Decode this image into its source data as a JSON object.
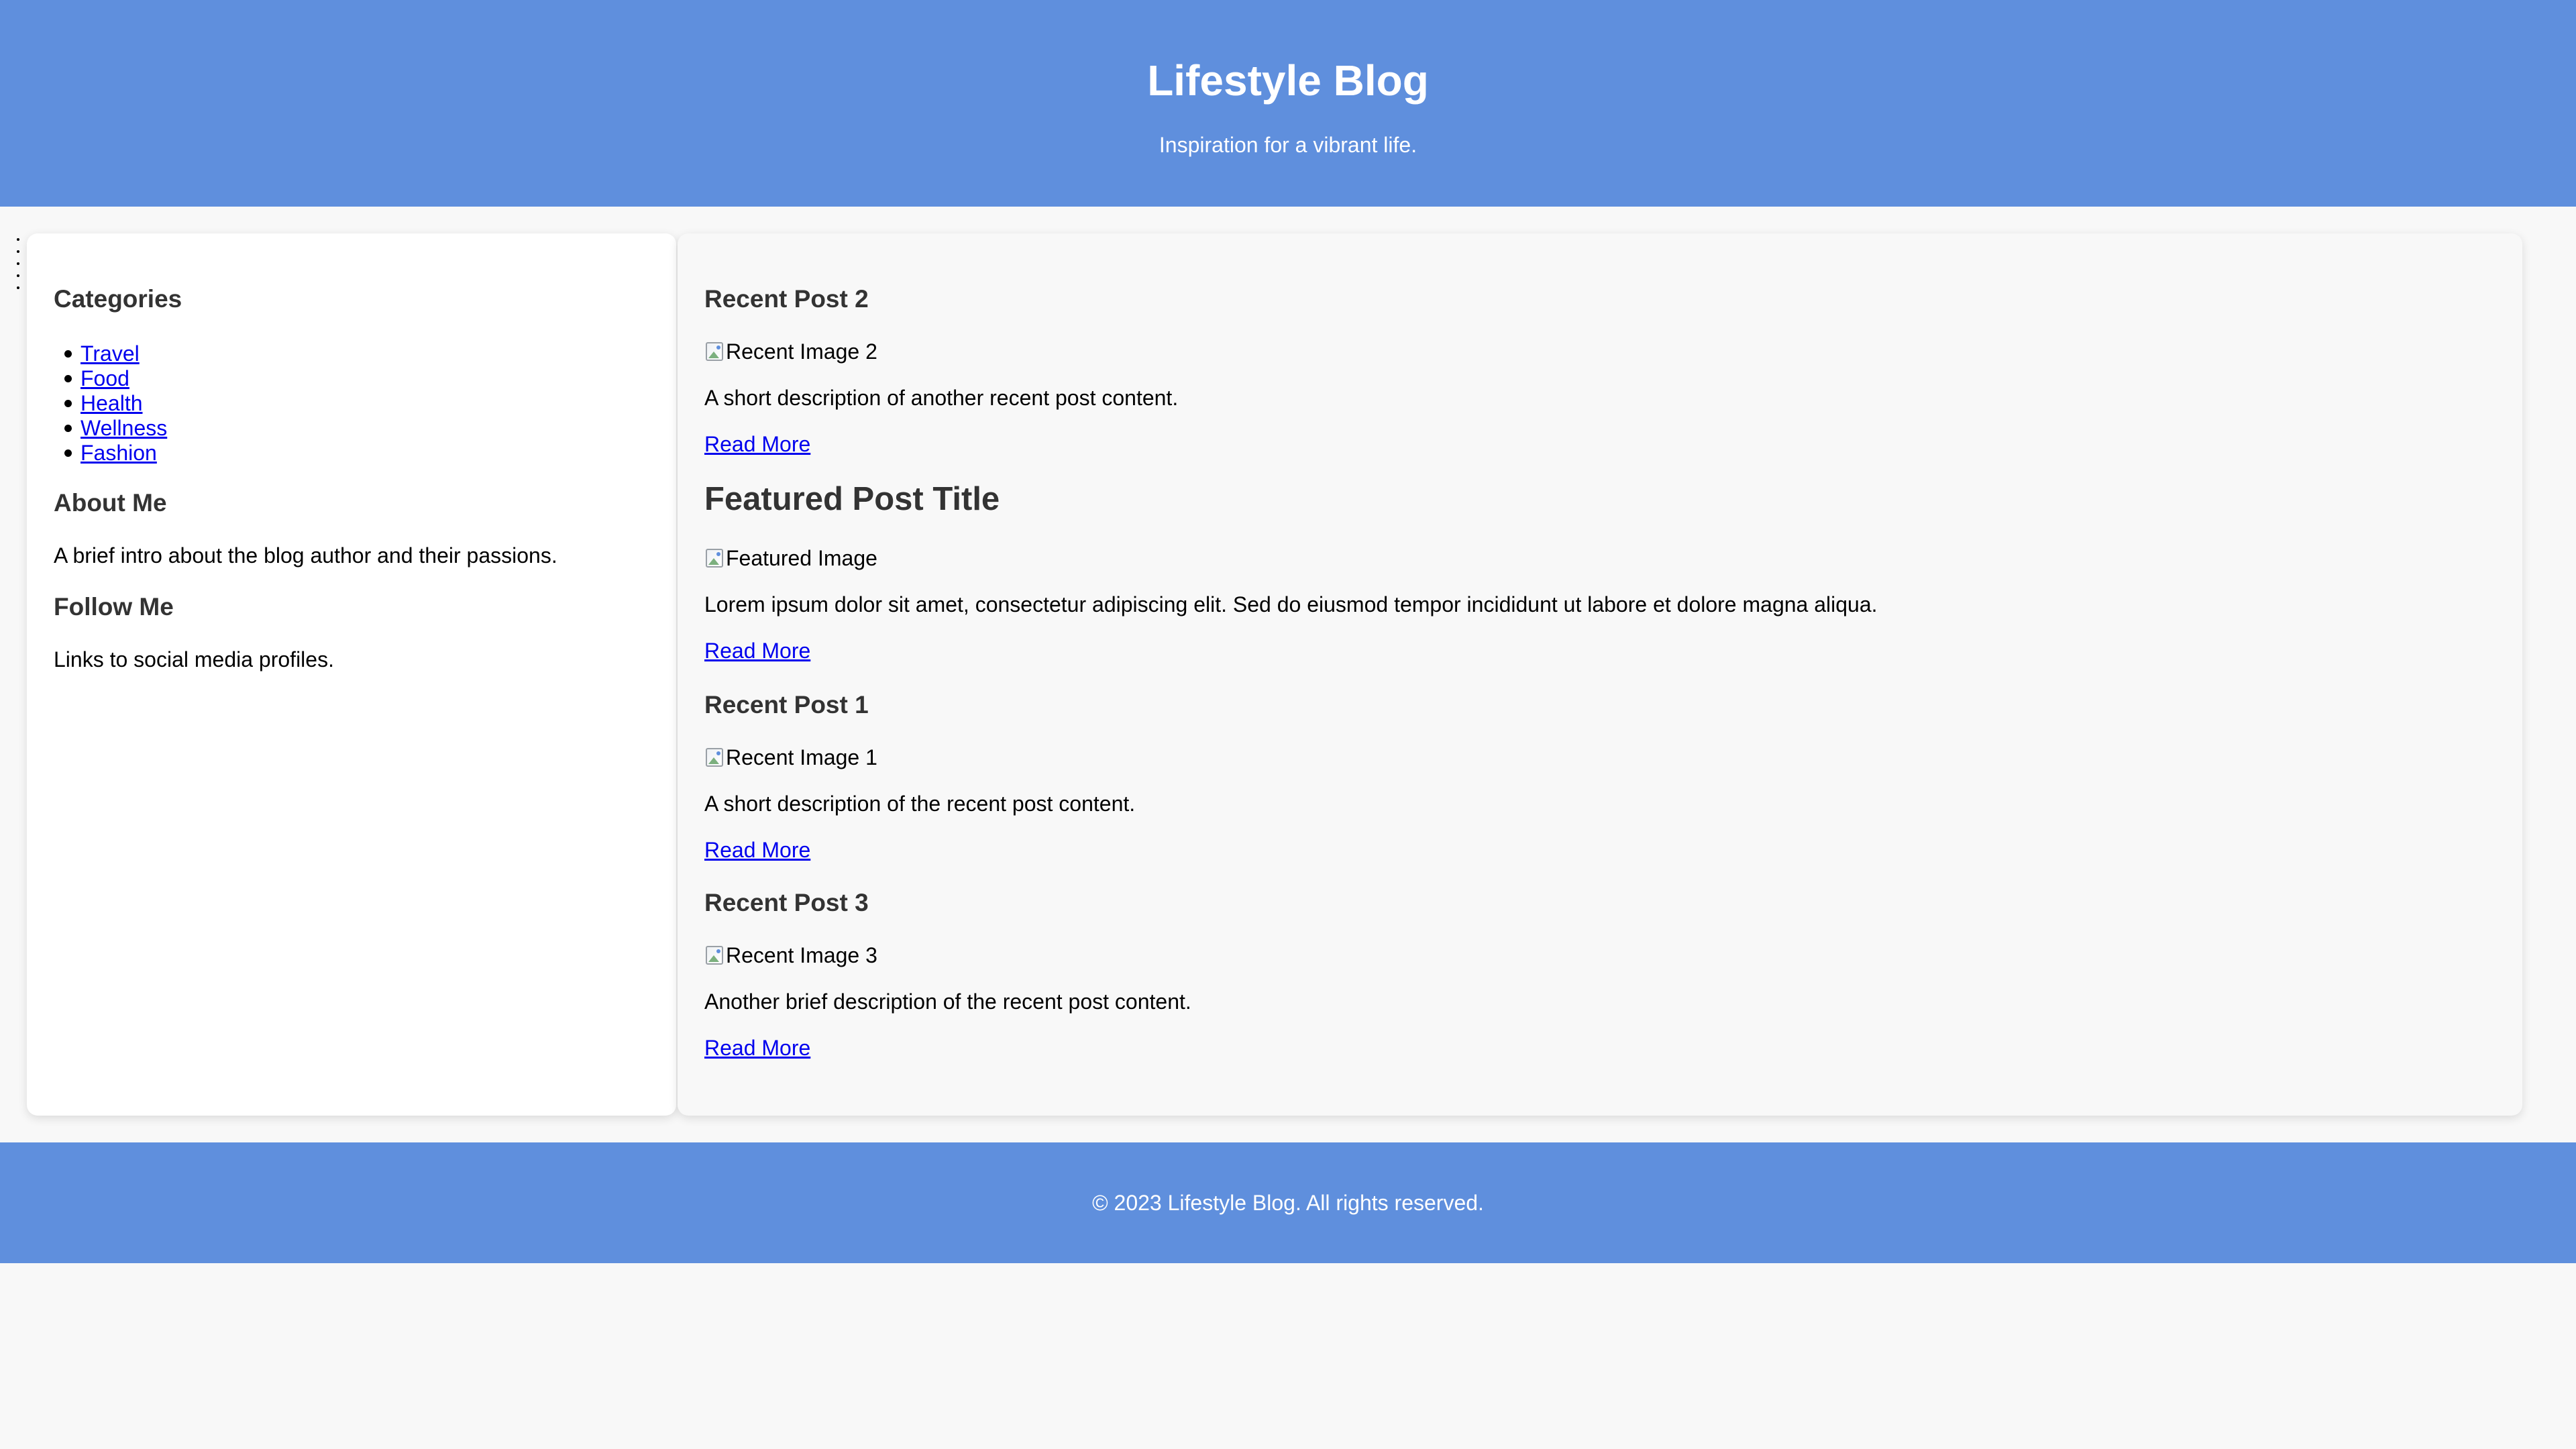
{
  "header": {
    "title": "Lifestyle Blog",
    "tagline": "Inspiration for a vibrant life."
  },
  "sidebar": {
    "categories_heading": "Categories",
    "categories": [
      "Travel",
      "Food",
      "Health",
      "Wellness",
      "Fashion"
    ],
    "about_heading": "About Me",
    "about_text": "A brief intro about the blog author and their passions.",
    "follow_heading": "Follow Me",
    "follow_text": "Links to social media profiles."
  },
  "main": {
    "posts": [
      {
        "title": "Recent Post 2",
        "image_alt": "Recent Image 2",
        "description": "A short description of another recent post content.",
        "link": "Read More"
      },
      {
        "title": "Featured Post Title",
        "image_alt": "Featured Image",
        "description": "Lorem ipsum dolor sit amet, consectetur adipiscing elit. Sed do eiusmod tempor incididunt ut labore et dolore magna aliqua.",
        "link": "Read More"
      },
      {
        "title": "Recent Post 1",
        "image_alt": "Recent Image 1",
        "description": "A short description of the recent post content.",
        "link": "Read More"
      },
      {
        "title": "Recent Post 3",
        "image_alt": "Recent Image 3",
        "description": "Another brief description of the recent post content.",
        "link": "Read More"
      }
    ]
  },
  "footer": {
    "copyright": "© 2023 Lifestyle Blog. All rights reserved."
  },
  "colors": {
    "header_bg": "#5f8fdd",
    "footer_bg": "#5f8fdd",
    "page_bg": "#f8f8f8",
    "link": "#0000ee",
    "heading": "#333333"
  }
}
